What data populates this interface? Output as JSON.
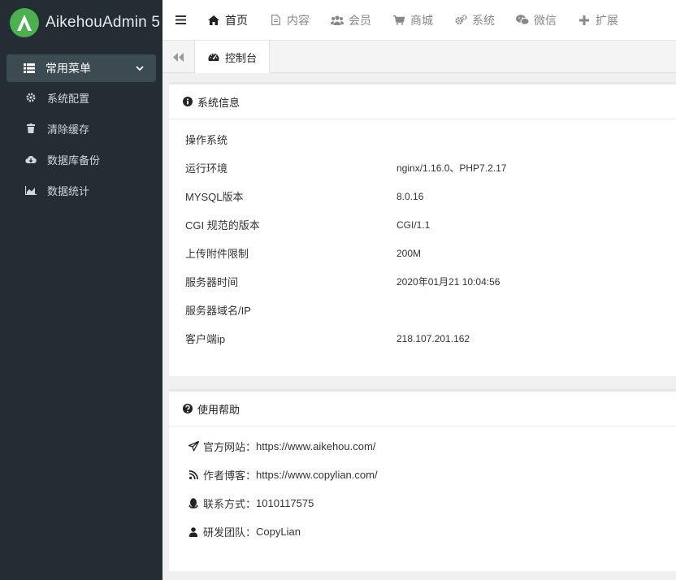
{
  "brand": {
    "name": "AikehouAdmin 5",
    "accent": "#4caf50"
  },
  "sidebar": {
    "group": {
      "label": "常用菜单",
      "icon": "list-icon"
    },
    "items": [
      {
        "label": "系统配置",
        "icon": "gear-icon"
      },
      {
        "label": "清除缓存",
        "icon": "trash-icon"
      },
      {
        "label": "数据库备份",
        "icon": "cloud-download-icon"
      },
      {
        "label": "数据统计",
        "icon": "area-chart-icon"
      }
    ]
  },
  "topnav": [
    {
      "label": "首页",
      "icon": "home-icon",
      "active": true
    },
    {
      "label": "内容",
      "icon": "file-icon"
    },
    {
      "label": "会员",
      "icon": "users-icon"
    },
    {
      "label": "商城",
      "icon": "cart-icon"
    },
    {
      "label": "系统",
      "icon": "cogs-icon"
    },
    {
      "label": "微信",
      "icon": "wechat-icon"
    },
    {
      "label": "扩展",
      "icon": "plus-icon"
    }
  ],
  "tabs": {
    "active_label": "控制台"
  },
  "sysinfo": {
    "title": "系统信息",
    "rows": [
      {
        "key": "操作系统",
        "value": ""
      },
      {
        "key": "运行环境",
        "value": "nginx/1.16.0、PHP7.2.17"
      },
      {
        "key": "MYSQL版本",
        "value": "8.0.16"
      },
      {
        "key": "CGI 规范的版本",
        "value": "CGI/1.1"
      },
      {
        "key": "上传附件限制",
        "value": "200M"
      },
      {
        "key": "服务器时间",
        "value": "2020年01月21 10:04:56"
      },
      {
        "key": "服务器域名/IP",
        "value": ""
      },
      {
        "key": "客户端ip",
        "value": "218.107.201.162"
      }
    ]
  },
  "help": {
    "title": "使用帮助",
    "rows": [
      {
        "key": "官方网站：",
        "value": "https://www.aikehou.com/",
        "icon": "paper-plane-icon"
      },
      {
        "key": "作者博客：",
        "value": "https://www.copylian.com/",
        "icon": "rss-icon"
      },
      {
        "key": "联系方式：",
        "value": "1010117575",
        "icon": "qq-icon"
      },
      {
        "key": "研发团队：",
        "value": "CopyLian",
        "icon": "user-icon"
      }
    ]
  }
}
